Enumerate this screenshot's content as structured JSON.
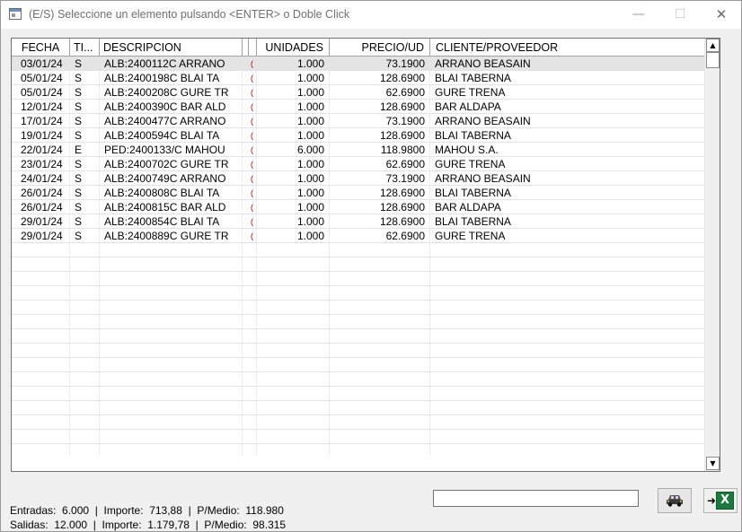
{
  "window": {
    "title": "(E/S) Seleccione un elemento pulsando <ENTER> o Doble Click",
    "minimize_glyph": "—",
    "maximize_glyph": "☐",
    "close_glyph": "✕"
  },
  "grid": {
    "columns": [
      "FECHA",
      "TI...",
      "DESCRIPCION",
      "",
      "",
      "UNIDADES",
      "PRECIO/UD",
      "CLIENTE/PROVEEDOR"
    ],
    "rows": [
      {
        "fecha": "03/01/24",
        "tipo": "S",
        "descripcion": "ALB:2400112C ARRANO",
        "extra": "(",
        "unidades": "1.000",
        "precio": "73.1900",
        "cliente": "ARRANO BEASAIN"
      },
      {
        "fecha": "05/01/24",
        "tipo": "S",
        "descripcion": "ALB:2400198C BLAI TA",
        "extra": "(",
        "unidades": "1.000",
        "precio": "128.6900",
        "cliente": "BLAI TABERNA"
      },
      {
        "fecha": "05/01/24",
        "tipo": "S",
        "descripcion": "ALB:2400208C GURE TR",
        "extra": "(",
        "unidades": "1.000",
        "precio": "62.6900",
        "cliente": "GURE TRENA"
      },
      {
        "fecha": "12/01/24",
        "tipo": "S",
        "descripcion": "ALB:2400390C BAR ALD",
        "extra": "(",
        "unidades": "1.000",
        "precio": "128.6900",
        "cliente": "BAR ALDAPA"
      },
      {
        "fecha": "17/01/24",
        "tipo": "S",
        "descripcion": "ALB:2400477C ARRANO",
        "extra": "(",
        "unidades": "1.000",
        "precio": "73.1900",
        "cliente": "ARRANO BEASAIN"
      },
      {
        "fecha": "19/01/24",
        "tipo": "S",
        "descripcion": "ALB:2400594C BLAI TA",
        "extra": "(",
        "unidades": "1.000",
        "precio": "128.6900",
        "cliente": "BLAI TABERNA"
      },
      {
        "fecha": "22/01/24",
        "tipo": "E",
        "descripcion": "PED:2400133/C MAHOU",
        "extra": "(",
        "unidades": "6.000",
        "precio": "118.9800",
        "cliente": "MAHOU S.A."
      },
      {
        "fecha": "23/01/24",
        "tipo": "S",
        "descripcion": "ALB:2400702C GURE TR",
        "extra": "(",
        "unidades": "1.000",
        "precio": "62.6900",
        "cliente": "GURE TRENA"
      },
      {
        "fecha": "24/01/24",
        "tipo": "S",
        "descripcion": "ALB:2400749C ARRANO",
        "extra": "(",
        "unidades": "1.000",
        "precio": "73.1900",
        "cliente": "ARRANO BEASAIN"
      },
      {
        "fecha": "26/01/24",
        "tipo": "S",
        "descripcion": "ALB:2400808C BLAI TA",
        "extra": "(",
        "unidades": "1.000",
        "precio": "128.6900",
        "cliente": "BLAI TABERNA"
      },
      {
        "fecha": "26/01/24",
        "tipo": "S",
        "descripcion": "ALB:2400815C BAR ALD",
        "extra": "(",
        "unidades": "1.000",
        "precio": "128.6900",
        "cliente": "BAR ALDAPA"
      },
      {
        "fecha": "29/01/24",
        "tipo": "S",
        "descripcion": "ALB:2400854C BLAI TA",
        "extra": "(",
        "unidades": "1.000",
        "precio": "128.6900",
        "cliente": "BLAI TABERNA"
      },
      {
        "fecha": "29/01/24",
        "tipo": "S",
        "descripcion": "ALB:2400889C GURE TR",
        "extra": "(",
        "unidades": "1.000",
        "precio": "62.6900",
        "cliente": "GURE TRENA"
      }
    ],
    "selected_index": 0
  },
  "scrollbar": {
    "up_glyph": "▲",
    "down_glyph": "▼"
  },
  "search": {
    "value": ""
  },
  "buttons": {
    "excel_label": "X",
    "export_arrow": "➜"
  },
  "summary": {
    "line1": "Entradas:  6.000  |  Importe:  713,88  |  P/Medio:  118.980",
    "line2": "Salidas:  12.000  |  Importe:  1.179,78  |  P/Medio:  98.315"
  }
}
